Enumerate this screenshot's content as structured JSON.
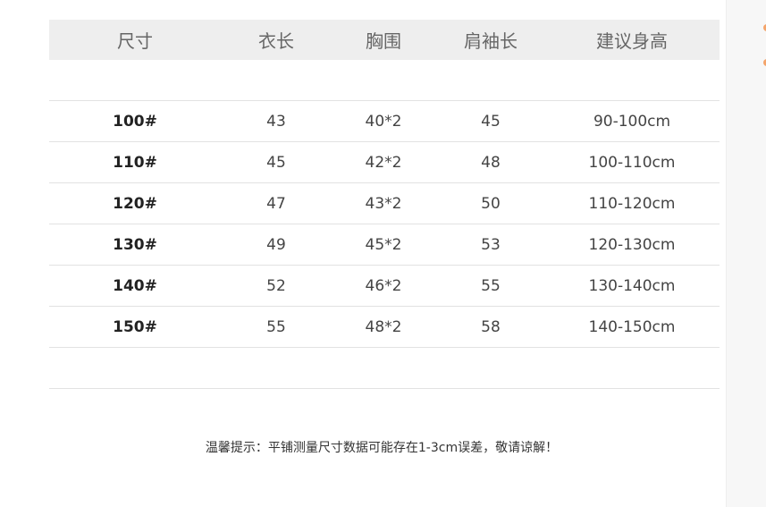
{
  "table": {
    "headers": [
      "尺寸",
      "衣长",
      "胸围",
      "肩袖长",
      "建议身高"
    ],
    "rows": [
      [
        "100#",
        "43",
        "40*2",
        "45",
        "90-100cm"
      ],
      [
        "110#",
        "45",
        "42*2",
        "48",
        "100-110cm"
      ],
      [
        "120#",
        "47",
        "43*2",
        "50",
        "110-120cm"
      ],
      [
        "130#",
        "49",
        "45*2",
        "53",
        "120-130cm"
      ],
      [
        "140#",
        "52",
        "46*2",
        "55",
        "130-140cm"
      ],
      [
        "150#",
        "55",
        "48*2",
        "58",
        "140-150cm"
      ]
    ]
  },
  "note": "温馨提示：平铺测量尺寸数据可能存在1-3cm误差，敬请谅解！",
  "colors": {
    "header_bg": "#eeeeee",
    "accent_dot": "#f4a46a",
    "divider": "#e2e2e2"
  }
}
